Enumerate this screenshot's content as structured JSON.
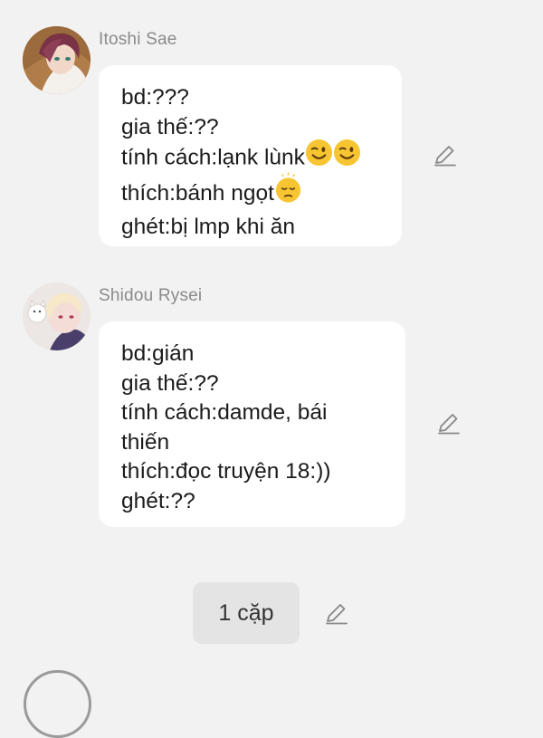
{
  "messages": [
    {
      "sender": "Itoshi Sae",
      "avatar": "avatar-itoshi-sae",
      "lines": {
        "l0": "bd:???",
        "l1": "gia thế:??",
        "l2": "tính cách:lạnk lùnk",
        "l3": "thích:bánh ngọt",
        "l4": "ghét:bị lmp khi ăn"
      },
      "emoji": {
        "l2": [
          "winking-face",
          "winking-face"
        ],
        "l3": [
          "pensive-face"
        ]
      }
    },
    {
      "sender": "Shidou Rysei",
      "avatar": "avatar-shidou-rysei",
      "lines": {
        "l0": "bd:gián",
        "l1": "gia thế:??",
        "l2": "tính cách:damde, bái",
        "l3": "thiến",
        "l4": "thích:đọc truyện 18:))",
        "l5": "ghét:??"
      }
    }
  ],
  "footer": {
    "pill_label": "1 cặp"
  },
  "icons": {
    "edit": "pencil-edit-icon"
  },
  "colors": {
    "background": "#f2f2f2",
    "bubble": "#ffffff",
    "sender_name": "#8a8a8a",
    "pill": "#e4e4e4",
    "emoji": "#f7c531"
  }
}
